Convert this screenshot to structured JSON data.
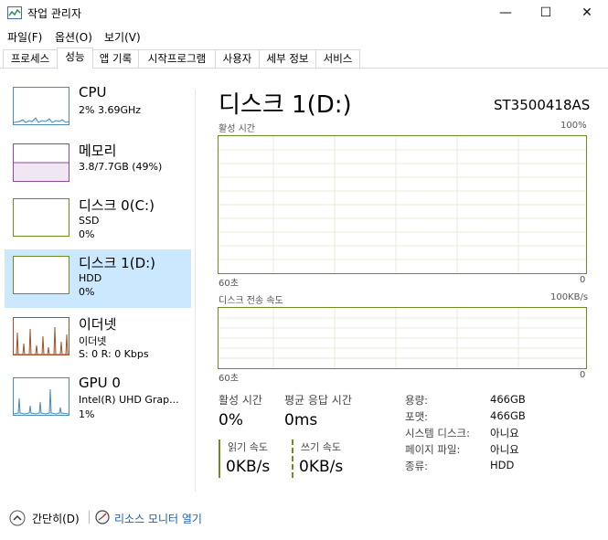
{
  "window": {
    "title": "작업 관리자",
    "controls": {
      "minimize": "—",
      "maximize": "☐",
      "close": "✕"
    }
  },
  "menu": [
    "파일(F)",
    "옵션(O)",
    "보기(V)"
  ],
  "tabs": [
    "프로세스",
    "성능",
    "앱 기록",
    "시작프로그램",
    "사용자",
    "세부 정보",
    "서비스"
  ],
  "active_tab": "성능",
  "sidebar": [
    {
      "name": "CPU",
      "sub1": "2% 3.69GHz",
      "sub2": "",
      "color": "#4a8bb5"
    },
    {
      "name": "메모리",
      "sub1": "3.8/7.7GB (49%)",
      "sub2": "",
      "color": "#8b4a9c"
    },
    {
      "name": "디스크 0(C:)",
      "sub1": "SSD",
      "sub2": "0%",
      "color": "#6b8e23"
    },
    {
      "name": "디스크 1(D:)",
      "sub1": "HDD",
      "sub2": "0%",
      "color": "#6b8e23"
    },
    {
      "name": "이더넷",
      "sub1": "이더넷",
      "sub2": "S: 0  R: 0 Kbps",
      "color": "#a0522d"
    },
    {
      "name": "GPU 0",
      "sub1": "Intel(R) UHD Grap...",
      "sub2": "1%",
      "color": "#4a8bb5"
    }
  ],
  "selected_sidebar": "디스크 1(D:)",
  "main": {
    "title": "디스크 1(D:)",
    "model": "ST3500418AS",
    "graph1": {
      "label": "활성 시간",
      "max": "100%",
      "time": "60초",
      "min": "0"
    },
    "graph2": {
      "label": "디스크 전송 속도",
      "max": "100KB/s",
      "time": "60초",
      "min": "0"
    },
    "stats": {
      "active_label": "활성 시간",
      "active_value": "0%",
      "resp_label": "평균 응답 시간",
      "resp_value": "0ms",
      "read_label": "읽기 속도",
      "read_value": "0KB/s",
      "write_label": "쓰기 속도",
      "write_value": "0KB/s"
    },
    "info": [
      {
        "label": "용량:",
        "value": "466GB"
      },
      {
        "label": "포맷:",
        "value": "466GB"
      },
      {
        "label": "시스템 디스크:",
        "value": "아니요"
      },
      {
        "label": "페이지 파일:",
        "value": "아니요"
      },
      {
        "label": "종류:",
        "value": "HDD"
      }
    ]
  },
  "footer": {
    "fewer": "간단히(D)",
    "resmon": "리소스 모니터 열기"
  }
}
